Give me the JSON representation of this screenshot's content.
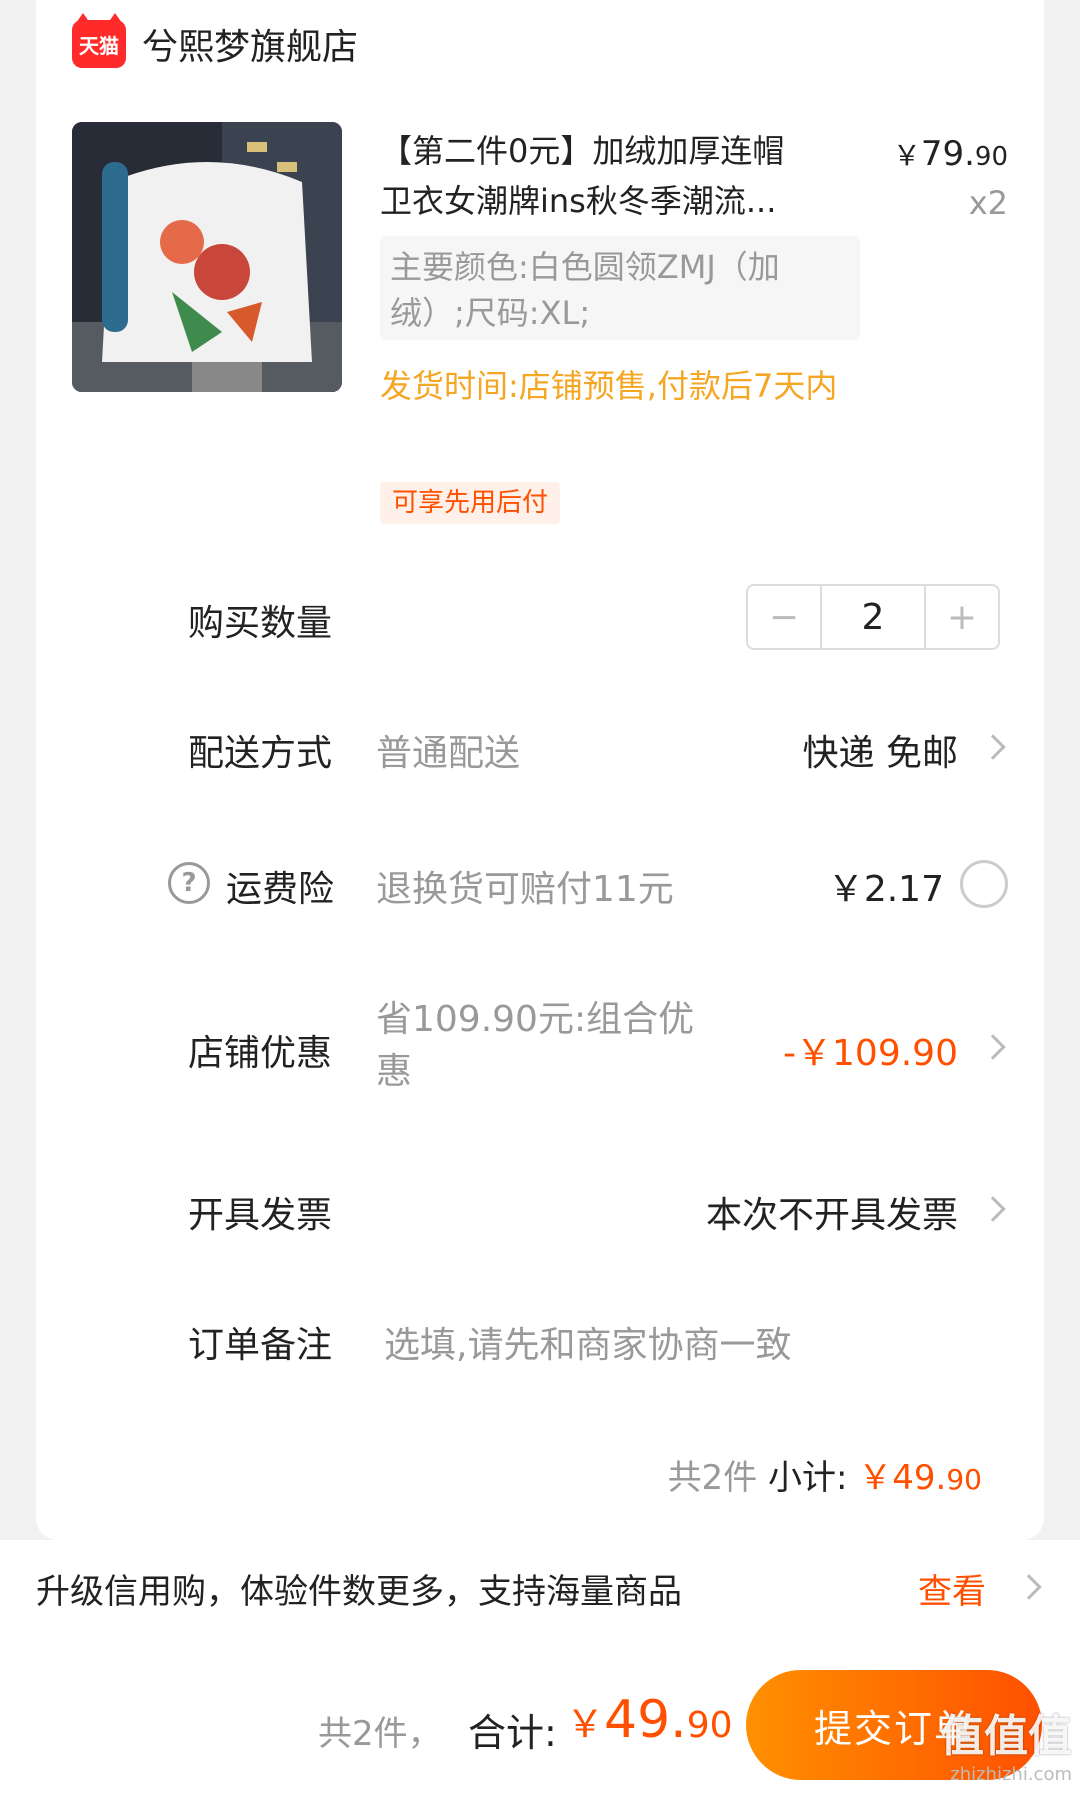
{
  "shop": {
    "badge_text": "天猫",
    "name": "兮熙梦旗舰店"
  },
  "product": {
    "title": "【第二件0元】加绒加厚连帽\n卫衣女潮牌ins秋冬季潮流...",
    "price_yen": "￥",
    "price_int": "79.",
    "price_cents": "90",
    "quantity_label": "x2",
    "sku": "主要颜色:白色圆领ZMJ（加绒）;尺码:XL;",
    "ship_time": "发货时间:店铺预售,付款后7天内",
    "tag": "可享先用后付"
  },
  "quantity": {
    "label": "购买数量",
    "minus": "−",
    "value": "2",
    "plus": "+"
  },
  "delivery": {
    "label": "配送方式",
    "mid": "普通配送",
    "value": "快递 免邮"
  },
  "insurance": {
    "help": "?",
    "label": "运费险",
    "mid": "退换货可赔付11元",
    "value": "￥2.17"
  },
  "discount": {
    "label": "店铺优惠",
    "mid": "省109.90元:组合优惠",
    "value": "-￥109.90"
  },
  "invoice": {
    "label": "开具发票",
    "value": "本次不开具发票"
  },
  "remark": {
    "label": "订单备注",
    "placeholder": "选填,请先和商家协商一致"
  },
  "subtotal": {
    "count": "共2件",
    "label": " 小计: ",
    "yen": "￥",
    "int": "49.",
    "cents": "90"
  },
  "credit": {
    "text": "升级信用购，体验件数更多，支持海量商品",
    "link": "查看"
  },
  "footer": {
    "count": "共2件，",
    "label": "合计:",
    "yen": "￥",
    "int": "49.",
    "cents": "90",
    "submit": "提交订单"
  },
  "watermark": {
    "big": "值值值",
    "small": "zhizhizhi.com"
  },
  "colors": {
    "accent": "#ff5000",
    "ship_time": "#f5a623",
    "tmall_red": "#ff2a2a"
  }
}
